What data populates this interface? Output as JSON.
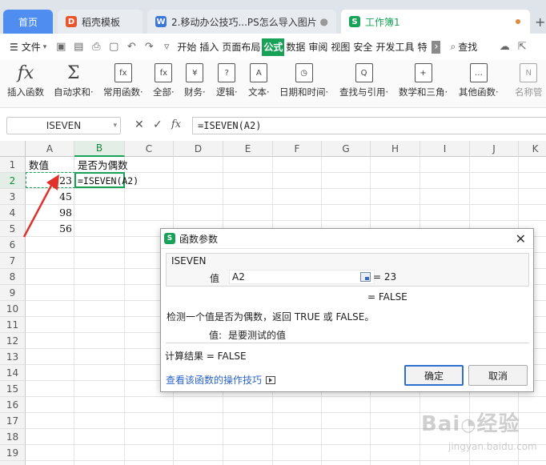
{
  "tabs": [
    {
      "label": "首页"
    },
    {
      "label": "稻壳模板"
    },
    {
      "label": "2.移动办公技巧...PS怎么导入图片"
    },
    {
      "label": "工作簿1"
    }
  ],
  "tab_new_symbol": "+",
  "menu": {
    "file_label": "文件",
    "items": [
      "开始",
      "插入",
      "页面布局",
      "公式",
      "数据",
      "审阅",
      "视图",
      "安全",
      "开发工具",
      "特"
    ],
    "active_item": "公式",
    "search_label": "查找"
  },
  "ribbon": {
    "buttons": [
      {
        "label": "插入函数",
        "icon": "fx"
      },
      {
        "label": "自动求和·",
        "icon": "Σ"
      },
      {
        "label": "常用函数·",
        "icon": "fx"
      },
      {
        "label": "全部·",
        "icon": "fx"
      },
      {
        "label": "财务·",
        "icon": "¥"
      },
      {
        "label": "逻辑·",
        "icon": "?"
      },
      {
        "label": "文本·",
        "icon": "A"
      },
      {
        "label": "日期和时间·",
        "icon": "◷"
      },
      {
        "label": "查找与引用·",
        "icon": "Q"
      },
      {
        "label": "数学和三角·",
        "icon": "+"
      },
      {
        "label": "其他函数·",
        "icon": "…"
      },
      {
        "label": "名称管",
        "icon": "N"
      }
    ]
  },
  "formula_bar": {
    "name_box": "ISEVEN",
    "fx_symbol": "fx",
    "formula": "=ISEVEN(A2)"
  },
  "sheet": {
    "columns": [
      "A",
      "B",
      "C",
      "D",
      "E",
      "F",
      "G",
      "H",
      "I",
      "J",
      "K"
    ],
    "rows": [
      "1",
      "2",
      "3",
      "4",
      "5",
      "6",
      "7",
      "8",
      "9",
      "10",
      "11",
      "12",
      "13",
      "14",
      "15",
      "16",
      "17",
      "18",
      "19",
      "20"
    ],
    "selected_column": "B",
    "selected_row": "2",
    "cells": {
      "A1": "数值",
      "B1": "是否为偶数",
      "A2": "23",
      "B2": "=ISEVEN(A2)",
      "A3": "45",
      "A4": "98",
      "A5": "56"
    }
  },
  "dialog": {
    "title": "函数参数",
    "function_name": "ISEVEN",
    "arg_label": "值",
    "arg_value": "A2",
    "arg_result": "= 23",
    "function_result": "= FALSE",
    "description": "检测一个值是否为偶数，返回 TRUE 或 FALSE。",
    "arg_desc_label": "值:",
    "arg_desc": "是要测试的值",
    "calc_result_label": "计算结果 = FALSE",
    "help_link": "查看该函数的操作技巧",
    "ok_label": "确定",
    "cancel_label": "取消"
  },
  "colors": {
    "accent_green": "#17a257",
    "home_tab_blue": "#4f8ef0",
    "arrow_red": "#e0312b",
    "link_blue": "#2b64c8"
  }
}
